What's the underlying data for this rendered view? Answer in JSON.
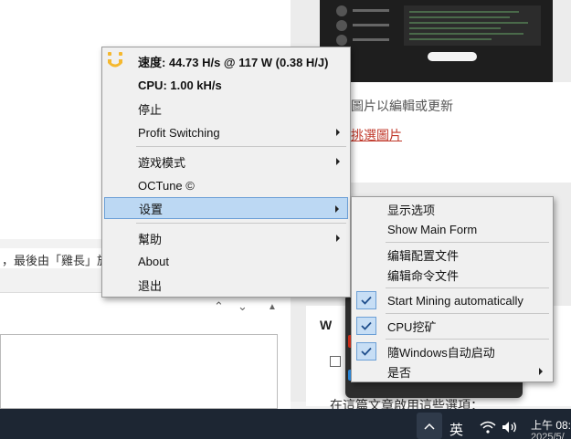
{
  "background": {
    "right_panel_text1": "圖片以編輯或更新",
    "right_panel_link": "挑選圖片",
    "post_info_text": "，最後由「雞長」於 2",
    "widget_title": "W",
    "bottom_text": "在這篇文章啟用這些選項："
  },
  "main_menu": {
    "items": [
      {
        "label": "速度: 44.73 H/s @ 117 W (0.38 H/J)",
        "bold": true
      },
      {
        "label": "CPU: 1.00 kH/s",
        "bold": true
      },
      {
        "label": "停止"
      },
      {
        "label": "Profit Switching"
      },
      {
        "label": "遊戏模式"
      },
      {
        "label": "OCTune ©"
      },
      {
        "label": "设置"
      },
      {
        "label": "幫助"
      },
      {
        "label": "About"
      },
      {
        "label": "退出"
      }
    ]
  },
  "settings_submenu": {
    "items": [
      {
        "label": "显示选项"
      },
      {
        "label": "Show Main Form"
      },
      {
        "label": "编辑配置文件"
      },
      {
        "label": "编辑命令文件"
      },
      {
        "label": "Start Mining automatically",
        "checked": true
      },
      {
        "label": "CPU挖矿",
        "checked": true
      },
      {
        "label": "隨Windows自动启动",
        "checked": true
      },
      {
        "label": "是否"
      }
    ]
  },
  "taskbar": {
    "lang": "英",
    "time": "上午 08:",
    "date": "2025/5/"
  },
  "colors": {
    "highlight": "#bcd8f3",
    "app_icon": "#f5b82e",
    "taskbar": "#1d2633"
  }
}
